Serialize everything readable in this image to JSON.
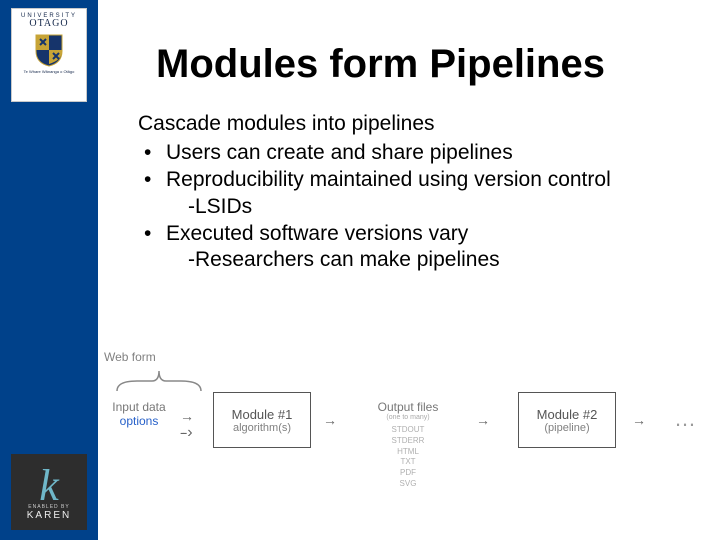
{
  "sidebar": {
    "otago": {
      "line1": "UNIVERSITY",
      "line2": "OTAGO",
      "strap": "Te Whare Wānanga o Otāgo"
    },
    "karen": {
      "enabled": "ENABLED BY",
      "name": "KAREN"
    }
  },
  "slide": {
    "title": "Modules form Pipelines",
    "lead": "Cascade modules into pipelines",
    "bullets": [
      {
        "text": "Users can create and share pipelines",
        "sub": null
      },
      {
        "text": "Reproducibility maintained using version control",
        "sub": "-LSIDs"
      },
      {
        "text": "Executed software versions vary",
        "sub": "-Researchers can make pipelines"
      }
    ]
  },
  "diagram": {
    "webform": "Web form",
    "input_data": "Input data",
    "options": "options",
    "module1": {
      "name": "Module #1",
      "sub": "algorithm(s)"
    },
    "output": {
      "title": "Output files",
      "count": "(one to many)",
      "formats": [
        "STDOUT",
        "STDERR",
        "HTML",
        "TXT",
        "PDF",
        "SVG"
      ]
    },
    "module2": {
      "name": "Module #2",
      "sub": "(pipeline)"
    },
    "ellipsis": "…"
  }
}
